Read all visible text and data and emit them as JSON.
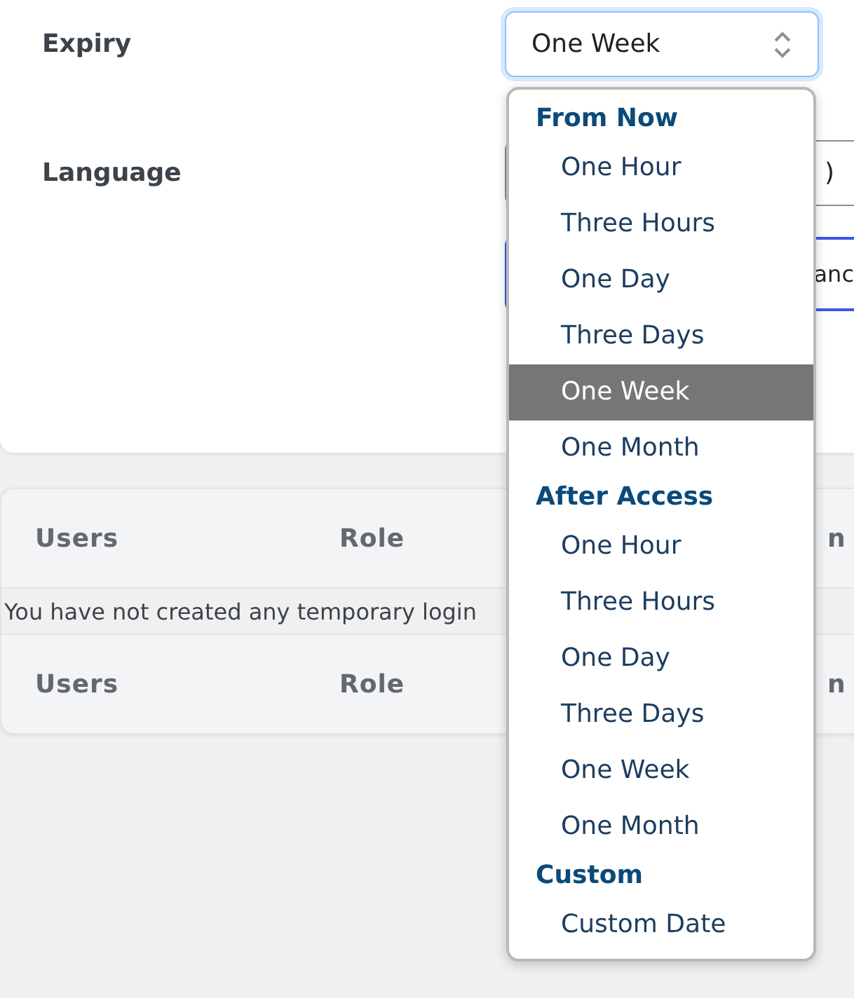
{
  "form": {
    "fields": [
      {
        "label": "Expiry",
        "value": "One Week",
        "focused": true
      },
      {
        "label": "Language",
        "value": ")",
        "focused": false
      }
    ],
    "button": {
      "label": "anc"
    }
  },
  "dropdown": {
    "groups": [
      {
        "heading": "From Now",
        "options": [
          {
            "label": "One Hour",
            "selected": false
          },
          {
            "label": "Three Hours",
            "selected": false
          },
          {
            "label": "One Day",
            "selected": false
          },
          {
            "label": "Three Days",
            "selected": false
          },
          {
            "label": "One Week",
            "selected": true
          },
          {
            "label": "One Month",
            "selected": false
          }
        ]
      },
      {
        "heading": "After Access",
        "options": [
          {
            "label": "One Hour",
            "selected": false
          },
          {
            "label": "Three Hours",
            "selected": false
          },
          {
            "label": "One Day",
            "selected": false
          },
          {
            "label": "Three Days",
            "selected": false
          },
          {
            "label": "One Week",
            "selected": false
          },
          {
            "label": "One Month",
            "selected": false
          }
        ]
      },
      {
        "heading": "Custom",
        "options": [
          {
            "label": "Custom Date",
            "selected": false
          }
        ]
      }
    ]
  },
  "table": {
    "columns": [
      "Users",
      "Role",
      "n"
    ],
    "empty_message": "You have not created any temporary login",
    "footer_columns": [
      "Users",
      "Role",
      "n"
    ]
  }
}
